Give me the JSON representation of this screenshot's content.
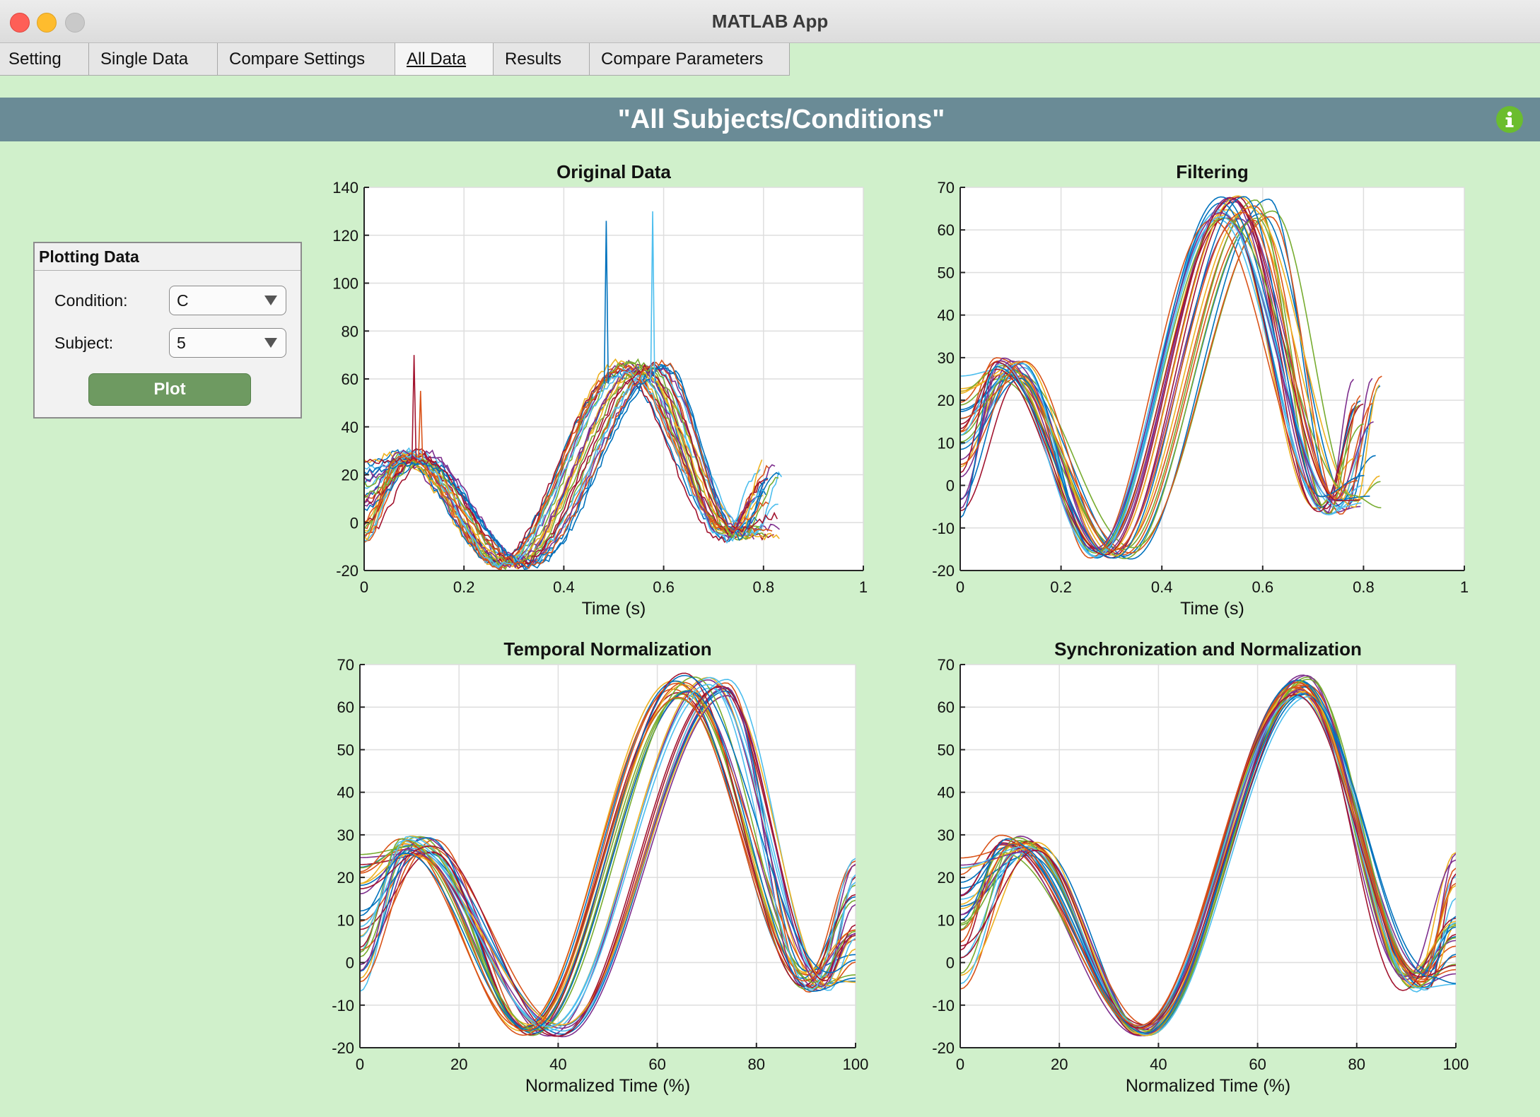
{
  "window": {
    "title": "MATLAB App"
  },
  "tabs": [
    {
      "label": "Setting"
    },
    {
      "label": "Single Data"
    },
    {
      "label": "Compare Settings"
    },
    {
      "label": "All Data",
      "active": true
    },
    {
      "label": "Results"
    },
    {
      "label": "Compare Parameters"
    }
  ],
  "header": {
    "title": "\"All Subjects/Conditions\"",
    "info_icon": "info-icon",
    "bar_color": "#6a8b96"
  },
  "plotting_panel": {
    "title": "Plotting Data",
    "condition_label": "Condition:",
    "condition_value": "C",
    "subject_label": "Subject:",
    "subject_value": "5",
    "plot_button": "Plot"
  },
  "chart_data": [
    {
      "type": "line",
      "title": "Original Data",
      "xlabel": "Time (s)",
      "ylabel": "",
      "xlim": [
        0,
        1
      ],
      "ylim": [
        -20,
        140
      ],
      "xticks": [
        0,
        0.2,
        0.4,
        0.6,
        0.8,
        1
      ],
      "yticks": [
        -20,
        0,
        20,
        40,
        60,
        80,
        100,
        120,
        140
      ],
      "grid": true,
      "series_count": 30,
      "note_peaks": [
        126,
        130,
        70,
        55
      ],
      "curve": {
        "peak1": 28,
        "trough": -17,
        "peak2": 66,
        "end_x": 0.82
      }
    },
    {
      "type": "line",
      "title": "Filtering",
      "xlabel": "Time (s)",
      "ylabel": "",
      "xlim": [
        0,
        1
      ],
      "ylim": [
        -20,
        70
      ],
      "xticks": [
        0,
        0.2,
        0.4,
        0.6,
        0.8,
        1
      ],
      "yticks": [
        -20,
        -10,
        0,
        10,
        20,
        30,
        40,
        50,
        60,
        70
      ],
      "grid": true,
      "series_count": 30,
      "curve": {
        "peak1": 28,
        "trough": -16,
        "peak2": 66,
        "end_x": 0.82
      }
    },
    {
      "type": "line",
      "title": "Temporal Normalization",
      "xlabel": "Normalized Time (%)",
      "ylabel": "",
      "xlim": [
        0,
        100
      ],
      "ylim": [
        -20,
        70
      ],
      "xticks": [
        0,
        20,
        40,
        60,
        80,
        100
      ],
      "yticks": [
        -20,
        -10,
        0,
        10,
        20,
        30,
        40,
        50,
        60,
        70
      ],
      "grid": true,
      "series_count": 30,
      "curve": {
        "peak1": 28,
        "trough": -16,
        "peak2": 66,
        "end_x": 100
      }
    },
    {
      "type": "line",
      "title": "Synchronization and Normalization",
      "xlabel": "Normalized Time (%)",
      "ylabel": "",
      "xlim": [
        0,
        100
      ],
      "ylim": [
        -20,
        70
      ],
      "xticks": [
        0,
        20,
        40,
        60,
        80,
        100
      ],
      "yticks": [
        -20,
        -10,
        0,
        10,
        20,
        30,
        40,
        50,
        60,
        70
      ],
      "grid": true,
      "series_count": 30,
      "curve": {
        "peak1": 28,
        "trough": -16,
        "peak2": 66,
        "end_x": 100
      }
    }
  ],
  "series_colors": [
    "#0072bd",
    "#d95319",
    "#edb120",
    "#7e2f8e",
    "#77ac30",
    "#4dbeee",
    "#a2142f"
  ]
}
